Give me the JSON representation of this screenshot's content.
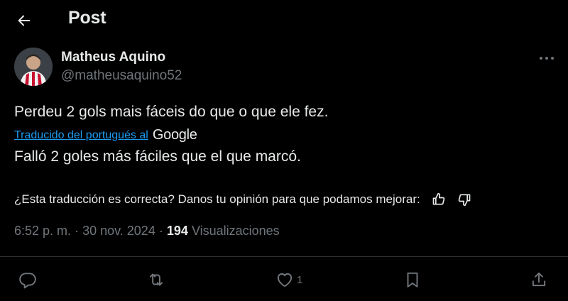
{
  "header": {
    "title": "Post"
  },
  "author": {
    "name": "Matheus Aquino",
    "handle": "@matheusaquino52"
  },
  "post": {
    "original_text": "Perdeu 2 gols mais fáceis do que o que ele fez.",
    "translated_by_label": "Traducido del portugués al",
    "translator_brand": "Google",
    "translated_text": "Falló 2 goles más fáciles que el que marcó."
  },
  "feedback": {
    "prompt": "¿Esta traducción es correcta? Danos tu opinión para que podamos mejorar:"
  },
  "meta": {
    "time": "6:52 p. m.",
    "separator1": "·",
    "date": "30 nov. 2024",
    "separator2": "·",
    "views_count": "194",
    "views_label": "Visualizaciones"
  },
  "actions": {
    "like_count": "1"
  },
  "colors": {
    "background": "#000000",
    "text": "#e7e9ea",
    "muted": "#71767b",
    "accent": "#1d9bf0",
    "divider": "#2f3336"
  },
  "icons": [
    "back-arrow-icon",
    "more-icon",
    "thumbs-up-icon",
    "thumbs-down-icon",
    "reply-icon",
    "repost-icon",
    "like-icon",
    "bookmark-icon",
    "share-icon"
  ]
}
